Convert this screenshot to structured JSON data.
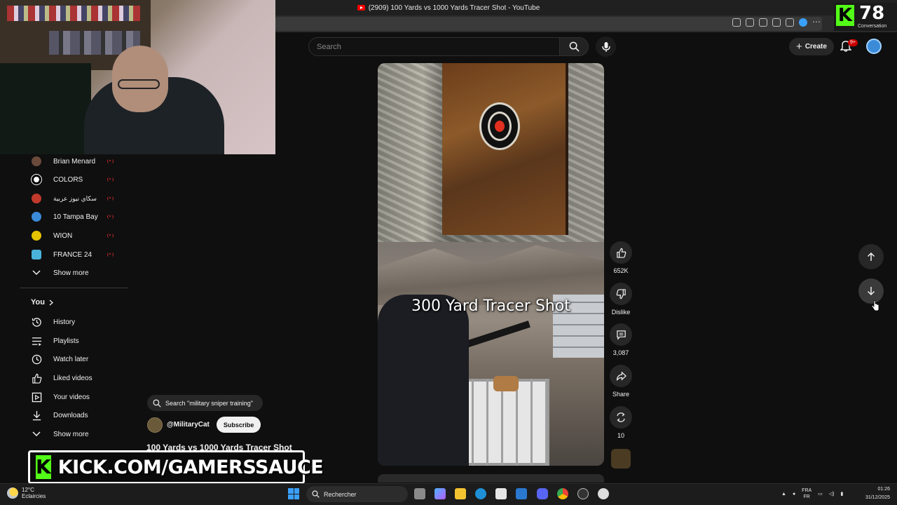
{
  "browser": {
    "tab_title": "(2909) 100 Yards vs 1000 Yards Tracer Shot - YouTube"
  },
  "kick_overlay": {
    "count": "78",
    "label": "Conversation",
    "banner_text": "KICK.COM/GAMERSSAUCE",
    "logo_letter": "K",
    "brand_color": "#53fc18"
  },
  "header": {
    "search_placeholder": "Search",
    "create_label": "Create",
    "notification_badge": "9+"
  },
  "sidebar": {
    "channels": [
      {
        "name": "Brian Menard",
        "avatar_color": "#6a4a3a",
        "live": true
      },
      {
        "name": "COLORS",
        "avatar_color": "#ffffff",
        "live": true
      },
      {
        "name": "سكاي نيوز عربية",
        "avatar_color": "#c0392b",
        "live": true
      },
      {
        "name": "10 Tampa Bay",
        "avatar_color": "#3a8ad9",
        "live": true
      },
      {
        "name": "WION",
        "avatar_color": "#e6c200",
        "live": true
      },
      {
        "name": "FRANCE 24",
        "avatar_color": "#4ab3d9",
        "live": true
      }
    ],
    "show_more_1": "Show more",
    "you_label": "You",
    "you_items": [
      {
        "label": "History",
        "icon": "history-icon"
      },
      {
        "label": "Playlists",
        "icon": "playlists-icon"
      },
      {
        "label": "Watch later",
        "icon": "watch-later-icon"
      },
      {
        "label": "Liked videos",
        "icon": "liked-videos-icon"
      },
      {
        "label": "Your videos",
        "icon": "your-videos-icon"
      },
      {
        "label": "Downloads",
        "icon": "downloads-icon"
      }
    ],
    "show_more_2": "Show more"
  },
  "short": {
    "suggested_search": "Search \"military sniper training\"",
    "channel_handle": "@MilitaryCat",
    "subscribe_label": "Subscribe",
    "title": "100 Yards vs 1000 Yards Tracer Shot",
    "overlay_caption": "300 Yard Tracer Shot",
    "actions": {
      "likes": "652K",
      "dislike_label": "Dislike",
      "comments": "3,087",
      "share_label": "Share",
      "remixes": "10"
    }
  },
  "taskbar": {
    "temperature": "12°C",
    "weather_desc": "Eclaircies",
    "search_label": "Rechercher",
    "lang_line1": "FRA",
    "lang_line2": "FR",
    "time": "01:26",
    "date": "31/12/2025"
  }
}
